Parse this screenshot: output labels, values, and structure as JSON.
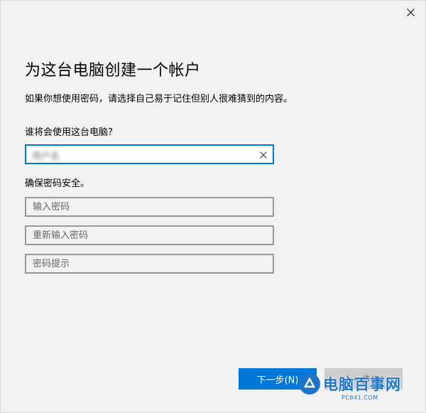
{
  "window": {
    "close_icon": "close-icon"
  },
  "page": {
    "title": "为这台电脑创建一个帐户",
    "subtitle": "如果你想使用密码，请选择自己易于记住但别人很难猜到的内容。",
    "who_label": "谁将会使用这台电脑?",
    "username_value": "用户名",
    "password_section_label": "确保密码安全。",
    "password_placeholder": "输入密码",
    "reenter_placeholder": "重新输入密码",
    "hint_placeholder": "密码提示"
  },
  "buttons": {
    "next_label": "下一步(N)",
    "back_label": "上一步(B)"
  },
  "watermark": {
    "text": "电脑百事网",
    "url": "PC841.COM"
  },
  "colors": {
    "accent": "#0078d7",
    "background": "#f2f2f2",
    "watermark": "#1f74c9"
  }
}
